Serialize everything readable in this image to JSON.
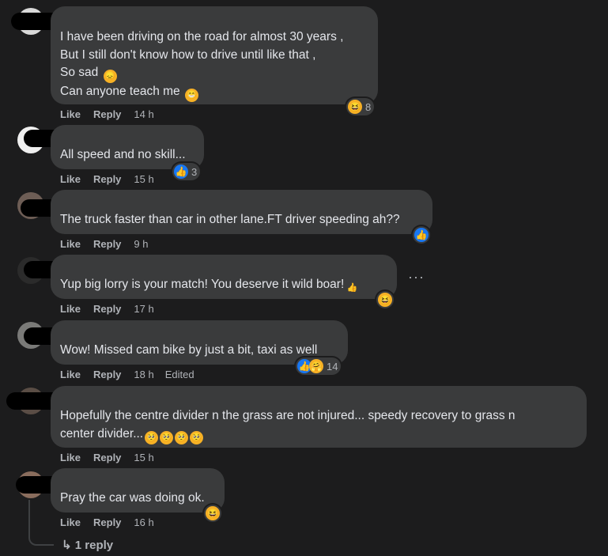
{
  "actions": {
    "like": "Like",
    "reply": "Reply"
  },
  "comments": [
    {
      "lines": [
        "I have been driving on the road for almost 30 years ,",
        "But I still don't know how to drive until like that ,",
        "So sad",
        "Can anyone teach me"
      ],
      "time": "14 h",
      "reaction_count": "8",
      "reaction_icons": [
        "haha-icon"
      ]
    },
    {
      "lines": [
        "All speed and no skill..."
      ],
      "time": "15 h",
      "reaction_count": "3",
      "reaction_icons": [
        "like-icon"
      ]
    },
    {
      "lines": [
        "The truck faster than car in other lane.FT driver speeding ah??"
      ],
      "time": "9 h",
      "reaction_count": "",
      "reaction_icons": [
        "like-icon"
      ]
    },
    {
      "lines": [
        "Yup big lorry is your match! You deserve it wild boar!"
      ],
      "time": "17 h",
      "reaction_count": "",
      "reaction_icons": [
        "haha-icon"
      ],
      "more_label": "···"
    },
    {
      "lines": [
        "Wow! Missed cam bike by just a bit, taxi as well"
      ],
      "time": "18 h",
      "edited": "Edited",
      "reaction_count": "14",
      "reaction_icons": [
        "like-icon",
        "care-icon"
      ]
    },
    {
      "lines": [
        "Hopefully the centre divider n the grass are not injured... speedy recovery to grass n",
        "center divider..."
      ],
      "time": "15 h",
      "reaction_count": "",
      "reaction_icons": []
    },
    {
      "lines": [
        "Pray the car was doing ok."
      ],
      "time": "16 h",
      "reaction_count": "",
      "reaction_icons": [
        "haha-icon"
      ]
    }
  ],
  "replies_link": "1 reply",
  "emoji": {
    "haha": "😆",
    "like": "👍",
    "care": "🤗",
    "sad": "😞",
    "grin": "😁",
    "thumb": "👍",
    "pleading": "🥺"
  }
}
